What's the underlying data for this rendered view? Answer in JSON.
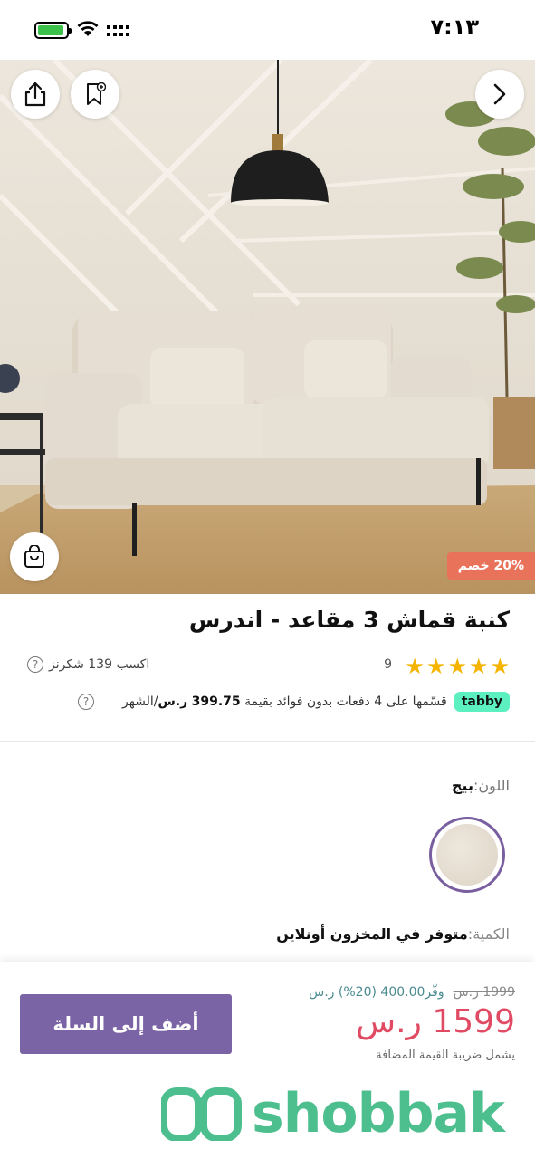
{
  "status_bar": {
    "time": "٧:١٣"
  },
  "icons": {
    "share": "share-icon",
    "save": "bookmark-icon",
    "next": "chevron-right-icon",
    "cart": "shopping-bag-icon",
    "help": "question-circle-icon",
    "battery": "battery-icon",
    "wifi": "wifi-icon",
    "signal": "signal-icon"
  },
  "product": {
    "discount_badge": "20% خصم",
    "title": "كنبة قماش 3 مقاعد - اندرس",
    "rating": 5,
    "review_count": "9",
    "points_text": "اكسب 139 شكرنز",
    "tabby_logo": "tabby",
    "tabby_text": "قسّمها على 4 دفعات بدون فوائد بقيمة",
    "tabby_amount": "399.75",
    "tabby_currency": "ر.س",
    "tabby_period": "/الشهر",
    "color_label": "اللون:",
    "color_value": "بيج",
    "qty_label": "الكمية:",
    "qty_value": "متوفر في المخزون أونلاين"
  },
  "purchase": {
    "add_to_cart": "أضف إلى السلة",
    "old_price": "1999 ر.س",
    "savings": "وفّر400.00 (20%) ر.س",
    "price": "1599 ر.س",
    "vat_note": "يشمل ضريبة القيمة المضافة"
  },
  "watermark": {
    "text": "shobbak"
  },
  "colors": {
    "accent": "#7b64a5",
    "price": "#e04b63",
    "discount": "#e8735a",
    "star": "#f5b400",
    "tabby": "#5cf0c0",
    "watermark": "#2fb37a"
  }
}
